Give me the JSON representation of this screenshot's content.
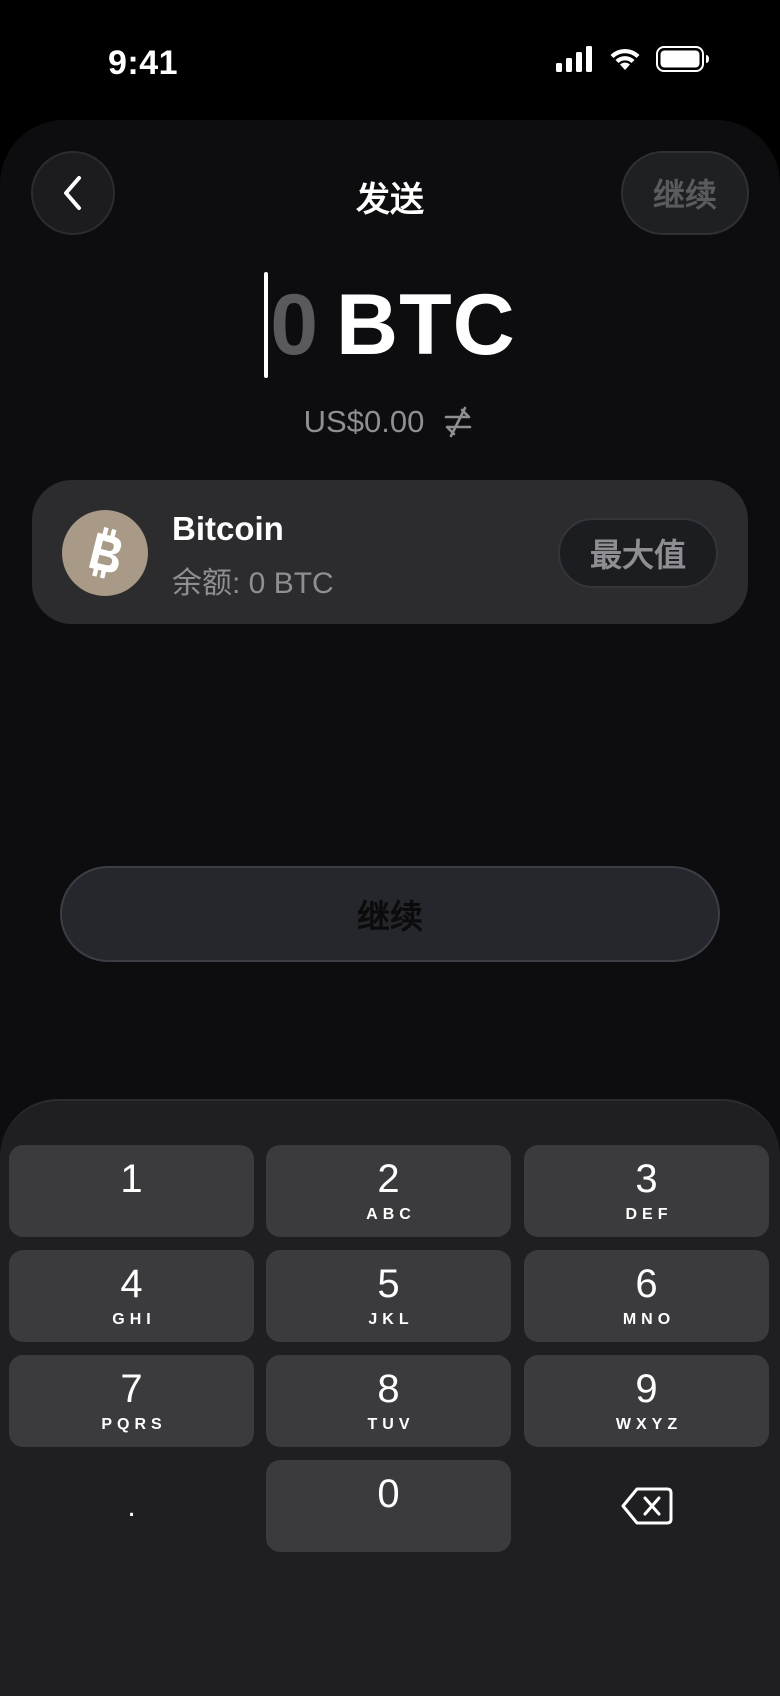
{
  "status_bar": {
    "time": "9:41",
    "icons": [
      "cellular-signal-icon",
      "wifi-icon",
      "battery-icon"
    ]
  },
  "nav": {
    "back_icon": "chevron-left-icon",
    "title": "发送",
    "continue_label": "继续"
  },
  "amount": {
    "value": "0",
    "unit": "BTC",
    "fiat_value": "US$0.00",
    "swap_icon": "swap-arrows-icon"
  },
  "asset": {
    "icon": "bitcoin-icon",
    "name": "Bitcoin",
    "balance": "余额: 0 BTC",
    "max_label": "最大值"
  },
  "continue_button": {
    "label": "继续"
  },
  "keypad": {
    "keys": [
      {
        "digit": "1",
        "letters": ""
      },
      {
        "digit": "2",
        "letters": "ABC"
      },
      {
        "digit": "3",
        "letters": "DEF"
      },
      {
        "digit": "4",
        "letters": "GHI"
      },
      {
        "digit": "5",
        "letters": "JKL"
      },
      {
        "digit": "6",
        "letters": "MNO"
      },
      {
        "digit": "7",
        "letters": "PQRS"
      },
      {
        "digit": "8",
        "letters": "TUV"
      },
      {
        "digit": "9",
        "letters": "WXYZ"
      },
      {
        "digit": "0",
        "letters": ""
      }
    ],
    "decimal_label": ".",
    "delete_icon": "backspace-icon"
  },
  "colors": {
    "background": "#000000",
    "sheet": "#0d0d0f",
    "card": "#2c2c2f",
    "key": "#3b3b3e",
    "keypad_panel": "#1f1f21",
    "bitcoin_badge": "#a89a87",
    "muted_text": "#8e8e93"
  }
}
